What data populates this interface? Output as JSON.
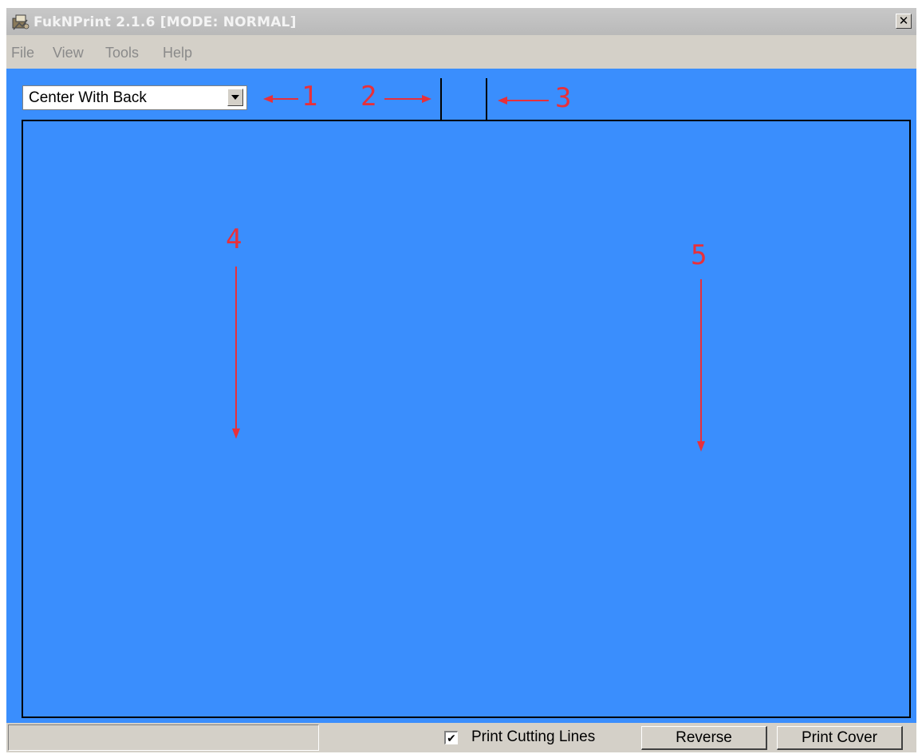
{
  "window": {
    "title": "FukNPrint  2.1.6  [MODE: NORMAL]",
    "close_label": "✕"
  },
  "menu": {
    "items": [
      "File",
      "View",
      "Tools",
      "Help"
    ]
  },
  "toolbar": {
    "layout_select": {
      "value": "Center With Back"
    }
  },
  "annotations": [
    "1",
    "2",
    "3",
    "4",
    "5"
  ],
  "statusbar": {
    "status_text": "",
    "print_cutting_lines": {
      "label": "Print Cutting Lines",
      "checked": true,
      "mark": "✔"
    },
    "reverse_label": "Reverse",
    "print_cover_label": "Print Cover"
  },
  "colors": {
    "canvas": "#3a8efd",
    "annotation": "#e8303a",
    "chrome": "#d4d0c8"
  },
  "icons": {
    "app": "app-icon",
    "close": "close-icon",
    "dropdown": "chevron-down-icon",
    "check": "checkmark-icon"
  }
}
